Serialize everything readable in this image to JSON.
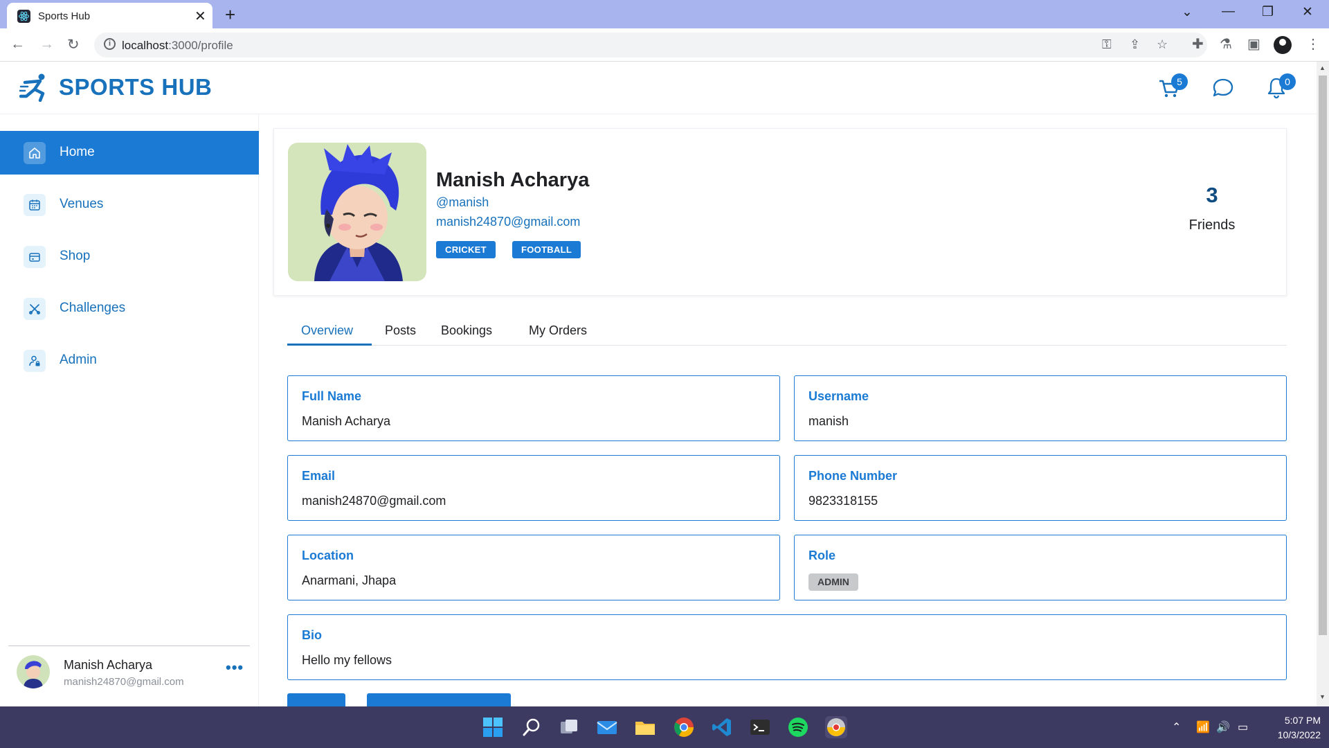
{
  "browser": {
    "tab_title": "Sports Hub",
    "url_host": "localhost",
    "url_path": ":3000/profile"
  },
  "app": {
    "logo_text": "SPORTS HUB",
    "cart_count": "5",
    "notification_count": "0"
  },
  "sidebar": {
    "items": [
      {
        "label": "Home"
      },
      {
        "label": "Venues"
      },
      {
        "label": "Shop"
      },
      {
        "label": "Challenges"
      },
      {
        "label": "Admin"
      }
    ],
    "user": {
      "name": "Manish Acharya",
      "email": "manish24870@gmail.com",
      "more": "•••"
    }
  },
  "profile": {
    "name": "Manish Acharya",
    "handle": "@manish",
    "email": "manish24870@gmail.com",
    "tags": [
      "CRICKET",
      "FOOTBALL"
    ],
    "friends_count": "3",
    "friends_label": "Friends"
  },
  "tabs": [
    "Overview",
    "Posts",
    "Bookings",
    "My Orders"
  ],
  "fields": {
    "full_name": {
      "label": "Full Name",
      "value": "Manish Acharya"
    },
    "username": {
      "label": "Username",
      "value": "manish"
    },
    "email": {
      "label": "Email",
      "value": "manish24870@gmail.com"
    },
    "phone": {
      "label": "Phone Number",
      "value": "9823318155"
    },
    "location": {
      "label": "Location",
      "value": "Anarmani, Jhapa"
    },
    "role": {
      "label": "Role",
      "value": "ADMIN"
    },
    "bio": {
      "label": "Bio",
      "value": "Hello my fellows"
    }
  },
  "taskbar": {
    "time": "5:07 PM",
    "date": "10/3/2022"
  },
  "colors": {
    "accent": "#1a7ad4",
    "brand": "#1771bb",
    "taskbar": "#3d3a62",
    "tabbar": "#a8b4ee"
  }
}
